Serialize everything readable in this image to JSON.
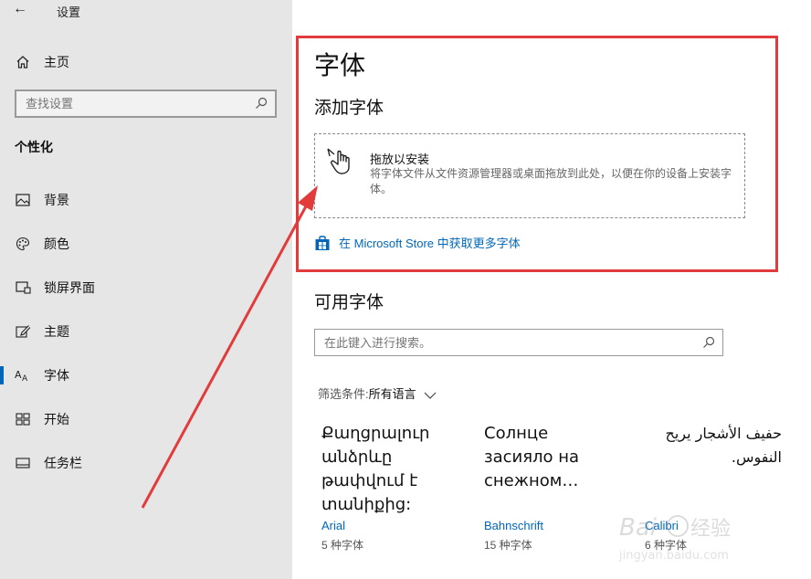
{
  "app": {
    "title": "设置",
    "back_glyph": "←"
  },
  "sidebar": {
    "home_label": "主页",
    "search_placeholder": "查找设置",
    "section_title": "个性化",
    "items": [
      {
        "label": "背景",
        "icon": "image-icon"
      },
      {
        "label": "颜色",
        "icon": "palette-icon"
      },
      {
        "label": "锁屏界面",
        "icon": "lock-screen-icon"
      },
      {
        "label": "主题",
        "icon": "theme-brush-icon"
      },
      {
        "label": "字体",
        "icon": "font-icon",
        "active": true
      },
      {
        "label": "开始",
        "icon": "start-tiles-icon"
      },
      {
        "label": "任务栏",
        "icon": "taskbar-icon"
      }
    ]
  },
  "main": {
    "title": "字体",
    "add_section_title": "添加字体",
    "dropzone": {
      "title": "拖放以安装",
      "description": "将字体文件从文件资源管理器或桌面拖放到此处，以便在你的设备上安装字体。"
    },
    "store_link": "在 Microsoft Store 中获取更多字体",
    "available_title": "可用字体",
    "font_search_placeholder": "在此键入进行搜索。",
    "filter_label": "筛选条件: ",
    "filter_value": "所有语言",
    "fonts": [
      {
        "sample": "Քաղցրալուր անձրևը թափվում է տանիքից:",
        "name": "Arial",
        "count": "5 种字体"
      },
      {
        "sample": "Солнце засияло на снежном…",
        "name": "Bahnschrift",
        "count": "15 种字体"
      },
      {
        "sample": "حفيف الأشجار يريح النفوس.",
        "name": "Calibri",
        "count": "6 种字体"
      }
    ]
  },
  "colors": {
    "accent": "#0067b8",
    "annotation": "#e23b3b",
    "sidebar_bg": "#e6e6e6"
  },
  "watermark": {
    "text": "Baidu 经验",
    "subtext": "jingyan.baidu.com"
  }
}
